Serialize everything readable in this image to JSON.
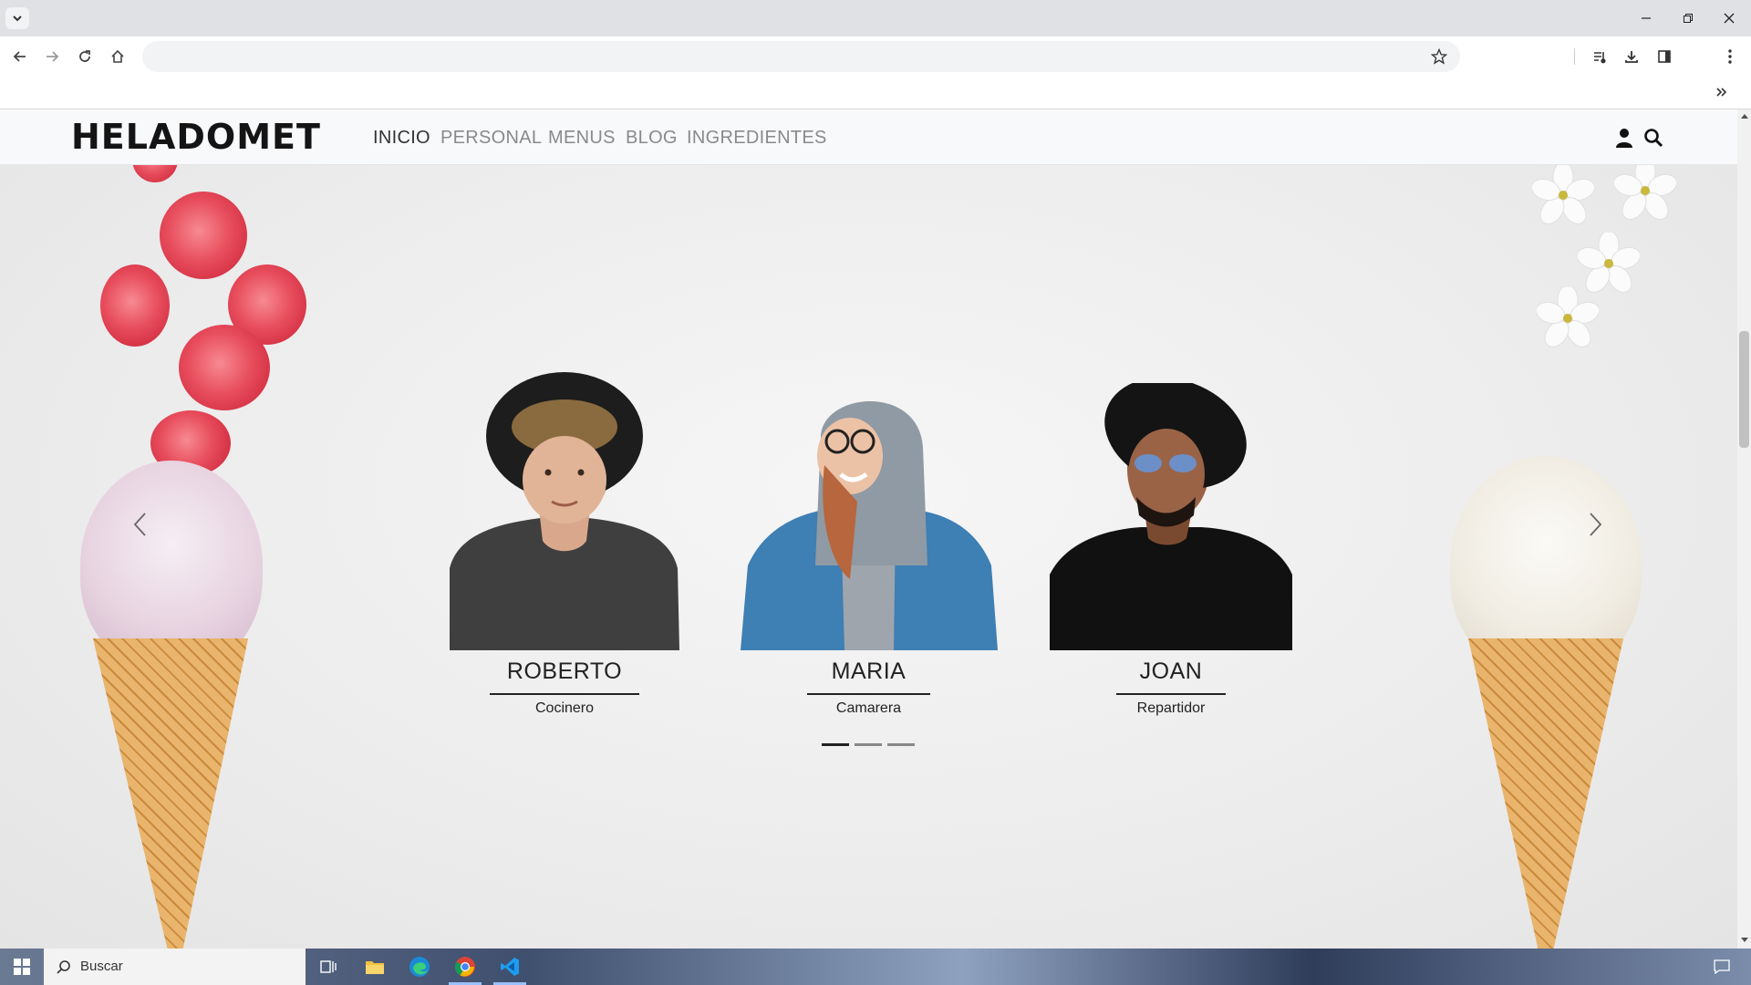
{
  "browser": {
    "tab_search_icon": "chevron-down-icon",
    "window_controls": [
      "minimize-icon",
      "restore-icon",
      "close-icon"
    ],
    "nav_icons": [
      "back-arrow-icon",
      "forward-arrow-icon",
      "reload-icon",
      "home-icon"
    ],
    "address_value": "",
    "toolbar_icons": [
      "bookmark-star-icon",
      "media-queue-icon",
      "download-icon",
      "side-panel-icon",
      "more-menu-icon"
    ],
    "bookmarks_overflow_icon": "double-chevron-icon"
  },
  "site": {
    "logo": "HELADOMET",
    "nav": [
      {
        "label": "INICIO",
        "active": true
      },
      {
        "label": "PERSONAL",
        "active": false
      },
      {
        "label": "MENUS",
        "active": false
      },
      {
        "label": "BLOG",
        "active": false
      },
      {
        "label": "INGREDIENTES",
        "active": false
      }
    ],
    "header_icons": [
      "user-icon",
      "search-icon"
    ]
  },
  "carousel": {
    "prev_icon": "chevron-left-icon",
    "next_icon": "chevron-right-icon",
    "cards": [
      {
        "name": "ROBERTO",
        "role": "Cocinero",
        "photo": "man-black-hat-curly-hair-photo"
      },
      {
        "name": "MARIA",
        "role": "Camarera",
        "photo": "woman-hoodie-denim-jacket-photo"
      },
      {
        "name": "JOAN",
        "role": "Repartidor",
        "photo": "man-hat-sunglasses-photo"
      }
    ],
    "indicators": 3,
    "active_indicator": 1
  },
  "colors": {
    "page_bg": "#eeeeee",
    "header_bg": "#f8f9fb",
    "nav_active": "#333333",
    "nav_inactive": "#8a8a8a",
    "text_dark": "#222222"
  },
  "taskbar": {
    "start_icon": "windows-logo-icon",
    "search_placeholder": "Buscar",
    "search_icon": "search-icon",
    "apps": [
      "task-view-icon",
      "file-explorer-icon",
      "edge-icon",
      "chrome-icon",
      "vscode-icon"
    ],
    "notification_icon": "notification-icon"
  }
}
